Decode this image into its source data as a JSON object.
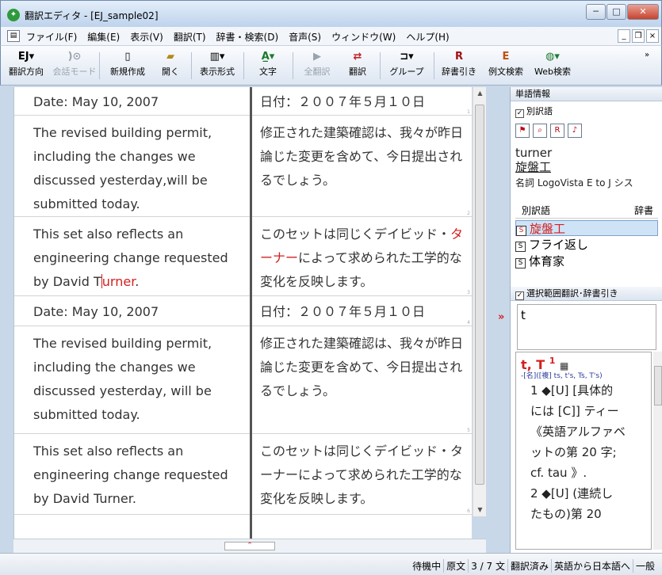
{
  "window": {
    "title": "翻訳エディタ - [EJ_sample02]"
  },
  "menu": [
    "ファイル(F)",
    "編集(E)",
    "表示(V)",
    "翻訳(T)",
    "辞書・検索(D)",
    "音声(S)",
    "ウィンドウ(W)",
    "ヘルプ(H)"
  ],
  "toolbar": {
    "direction": "翻訳方向",
    "conversation": "会話モード",
    "new": "新規作成",
    "open": "開く",
    "format": "表示形式",
    "text": "文字",
    "translate_all": "全翻訳",
    "translate": "翻訳",
    "group": "グループ",
    "dict_lookup": "辞書引き",
    "example_search": "例文検索",
    "web_search": "Web検索"
  },
  "segments": [
    {
      "source": "Date: May 10, 2007",
      "target": "日付：２００７年５月１０日",
      "num": "1"
    },
    {
      "source": "The revised building permit, including the changes we discussed yesterday,will be submitted today.",
      "target": "修正された建築確認は、我々が昨日論じた変更を含めて、今日提出されるでしょう。",
      "num": "2"
    },
    {
      "source_pre": "This set also reflects an engineering change requested by David T",
      "source_red": "urner",
      "source_post": ".",
      "target_pre": "このセットは同じくデイビッド・",
      "target_red": "ターナー",
      "target_post": "によって求められた工学的な変化を反映します。",
      "num": "3"
    },
    {
      "source": "Date: May 10, 2007",
      "target": "日付：２００７年５月１０日",
      "num": "4"
    },
    {
      "source": "The revised building permit, including the changes we discussed yesterday, will be submitted today.",
      "target": "修正された建築確認は、我々が昨日論じた変更を含めて、今日提出されるでしょう。",
      "num": "5"
    },
    {
      "source": "This set also reflects an engineering change requested by David Turner.",
      "target": "このセットは同じくデイビッド・ターナーによって求められた工学的な変化を反映します。",
      "num": "6"
    }
  ],
  "word_info": {
    "header": "単語情報",
    "alt_check": "別訳語",
    "word": "turner",
    "translation": "旋盤工",
    "pos": "名詞 LogoVista E to J シス",
    "col_alt": "別訳語",
    "col_dict": "辞書",
    "alternatives": [
      "旋盤工",
      "フライ返し",
      "体育家"
    ]
  },
  "selection": {
    "header": "選択範囲翻訳･辞書引き",
    "input": "t",
    "dict_head": "t, T",
    "dict_sup": "1",
    "dict_grammar": "-[名]([複] ts, t's, Ts, T's)",
    "dict_lines": [
      "1 ◆[U] [具体的",
      "には [C]] ティー",
      "《英語アルファベ",
      "ットの第 20 字;",
      "cf. tau 》.",
      "2 ◆[U] (連続し",
      "たもの)第 20"
    ]
  },
  "status": [
    "待機中",
    "原文",
    "3 / 7 文",
    "翻訳済み",
    "英語から日本語へ",
    "一般"
  ]
}
